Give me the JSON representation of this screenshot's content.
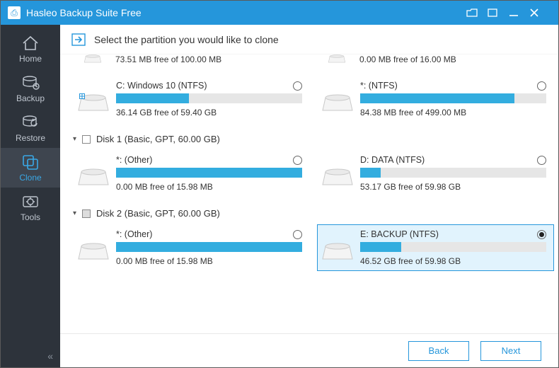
{
  "window": {
    "title": "Hasleo Backup Suite Free"
  },
  "sidebar": {
    "items": [
      {
        "label": "Home"
      },
      {
        "label": "Backup"
      },
      {
        "label": "Restore"
      },
      {
        "label": "Clone"
      },
      {
        "label": "Tools"
      }
    ],
    "active": 3
  },
  "instruction": "Select the partition you would like to clone",
  "row0": {
    "left": {
      "free": "73.51 MB free of 100.00 MB"
    },
    "right": {
      "free": "0.00 MB free of 16.00 MB"
    }
  },
  "rowA": {
    "left": {
      "label": "C: Windows 10 (NTFS)",
      "free": "36.14 GB free of 59.40 GB",
      "used_pct": 39
    },
    "right": {
      "label": "*: (NTFS)",
      "free": "84.38 MB free of 499.00 MB",
      "used_pct": 83
    }
  },
  "disk1": {
    "label": "Disk 1 (Basic, GPT, 60.00 GB)"
  },
  "rowB": {
    "left": {
      "label": "*: (Other)",
      "free": "0.00 MB free of 15.98 MB",
      "used_pct": 100
    },
    "right": {
      "label": "D: DATA (NTFS)",
      "free": "53.17 GB free of 59.98 GB",
      "used_pct": 11
    }
  },
  "disk2": {
    "label": "Disk 2 (Basic, GPT, 60.00 GB)"
  },
  "rowC": {
    "left": {
      "label": "*: (Other)",
      "free": "0.00 MB free of 15.98 MB",
      "used_pct": 100
    },
    "right": {
      "label": "E: BACKUP (NTFS)",
      "free": "46.52 GB free of 59.98 GB",
      "used_pct": 22
    }
  },
  "footer": {
    "back": "Back",
    "next": "Next"
  }
}
